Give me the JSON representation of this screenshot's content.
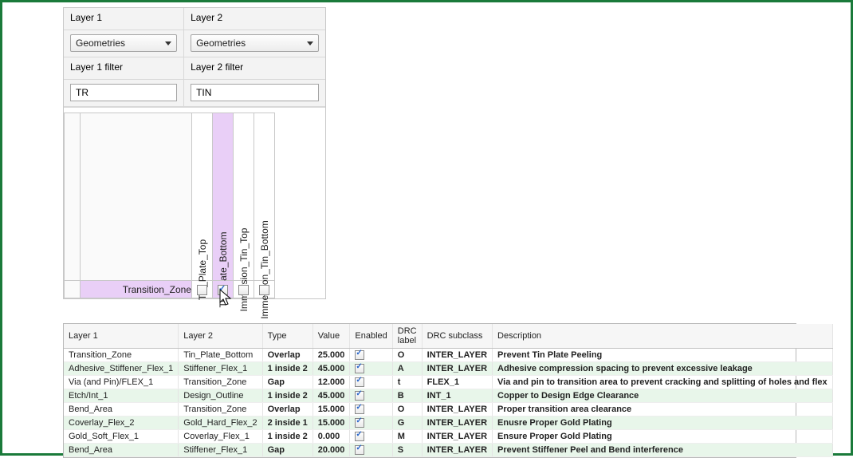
{
  "panel": {
    "layer1_label": "Layer 1",
    "layer2_label": "Layer 2",
    "layer1_dropdown": "Geometries",
    "layer2_dropdown": "Geometries",
    "layer1_filter_label": "Layer 1 filter",
    "layer2_filter_label": "Layer 2 filter",
    "layer1_filter_value": "TR",
    "layer2_filter_value": "TIN"
  },
  "matrix": {
    "row_header": "Transition_Zone",
    "columns": [
      {
        "label": "Tin_Plate_Top",
        "selected": false,
        "checked": false
      },
      {
        "label": "Tin_Plate_Bottom",
        "selected": true,
        "checked": true
      },
      {
        "label": "Immersion_Tin_Top",
        "selected": false,
        "checked": false
      },
      {
        "label": "Immersion_Tin_Bottom",
        "selected": false,
        "checked": false
      }
    ]
  },
  "table": {
    "headers": {
      "layer1": "Layer 1",
      "layer2": "Layer 2",
      "type": "Type",
      "value": "Value",
      "enabled": "Enabled",
      "drc_label": "DRC label",
      "drc_subclass": "DRC subclass",
      "description": "Description"
    },
    "rows": [
      {
        "layer1": "Transition_Zone",
        "layer2": "Tin_Plate_Bottom",
        "type": "Overlap",
        "value": "25.000",
        "enabled": true,
        "drc_label": "O",
        "drc_subclass": "INTER_LAYER",
        "description": "Prevent Tin Plate Peeling"
      },
      {
        "layer1": "Adhesive_Stiffener_Flex_1",
        "layer2": "Stiffener_Flex_1",
        "type": "1 inside 2",
        "value": "45.000",
        "enabled": true,
        "drc_label": "A",
        "drc_subclass": "INTER_LAYER",
        "description": "Adhesive compression spacing to prevent excessive leakage"
      },
      {
        "layer1": "Via (and Pin)/FLEX_1",
        "layer2": "Transition_Zone",
        "type": "Gap",
        "value": "12.000",
        "enabled": true,
        "drc_label": "t",
        "drc_subclass": "FLEX_1",
        "description": "Via and pin to transition area to prevent cracking and splitting of holes and flex"
      },
      {
        "layer1": "Etch/Int_1",
        "layer2": "Design_Outline",
        "type": "1 inside 2",
        "value": "45.000",
        "enabled": true,
        "drc_label": "B",
        "drc_subclass": "INT_1",
        "description": "Copper to Design Edge Clearance"
      },
      {
        "layer1": "Bend_Area",
        "layer2": "Transition_Zone",
        "type": "Overlap",
        "value": "15.000",
        "enabled": true,
        "drc_label": "O",
        "drc_subclass": "INTER_LAYER",
        "description": "Proper transition area clearance"
      },
      {
        "layer1": "Coverlay_Flex_2",
        "layer2": "Gold_Hard_Flex_2",
        "type": "2 inside 1",
        "value": "15.000",
        "enabled": true,
        "drc_label": "G",
        "drc_subclass": "INTER_LAYER",
        "description": "Enusre Proper Gold Plating"
      },
      {
        "layer1": "Gold_Soft_Flex_1",
        "layer2": "Coverlay_Flex_1",
        "type": "1 inside 2",
        "value": "0.000",
        "enabled": true,
        "drc_label": "M",
        "drc_subclass": "INTER_LAYER",
        "description": "Ensure Proper Gold Plating"
      },
      {
        "layer1": "Bend_Area",
        "layer2": "Stiffener_Flex_1",
        "type": "Gap",
        "value": "20.000",
        "enabled": true,
        "drc_label": "S",
        "drc_subclass": "INTER_LAYER",
        "description": "Prevent Stiffener Peel and Bend interference"
      }
    ]
  }
}
